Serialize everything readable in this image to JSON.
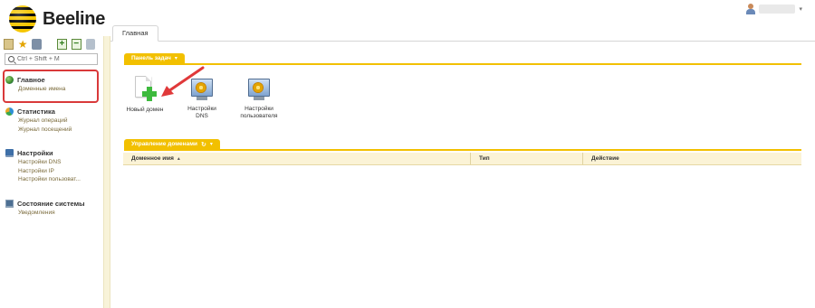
{
  "brand": {
    "name": "Beeline"
  },
  "user": {
    "icon": "user-icon",
    "caret": "▾"
  },
  "toolbar": {
    "icons": [
      "tree-icon",
      "star-icon",
      "camera-icon",
      "expand-icon",
      "collapse-icon",
      "pin-icon"
    ],
    "expand_label": "+",
    "collapse_label": "−"
  },
  "search": {
    "placeholder": "Ctrl + Shift + M"
  },
  "sidebar": {
    "groups": [
      {
        "title": "Главное",
        "icon": "globe-icon",
        "items": [
          "Доменные имена"
        ]
      },
      {
        "title": "Статистика",
        "icon": "stats-icon",
        "items": [
          "Журнал операций",
          "Журнал посещений"
        ]
      },
      {
        "title": "Настройки",
        "icon": "settings-icon",
        "items": [
          "Настройки DNS",
          "Настройки IP",
          "Настройки пользоват..."
        ]
      },
      {
        "title": "Состояние системы",
        "icon": "monitor-icon",
        "items": [
          "Уведомления"
        ]
      }
    ]
  },
  "tabs": [
    {
      "label": "Главная"
    }
  ],
  "task_panel": {
    "title": "Панель задач",
    "caret": "▾",
    "items": [
      {
        "label": "Новый домен",
        "icon": "new-document-icon"
      },
      {
        "label": "Настройки DNS",
        "icon": "dns-settings-icon"
      },
      {
        "label": "Настройки пользователя",
        "icon": "user-settings-icon"
      }
    ]
  },
  "domains_panel": {
    "title": "Управление доменами",
    "refresh": "↻",
    "caret": "▾",
    "columns": [
      {
        "label": "Доменное имя",
        "sort": "▲"
      },
      {
        "label": "Тип"
      },
      {
        "label": "Действие"
      }
    ]
  },
  "colors": {
    "accent": "#f2c000",
    "highlight": "#d9393a",
    "arrow": "#e0393a"
  }
}
